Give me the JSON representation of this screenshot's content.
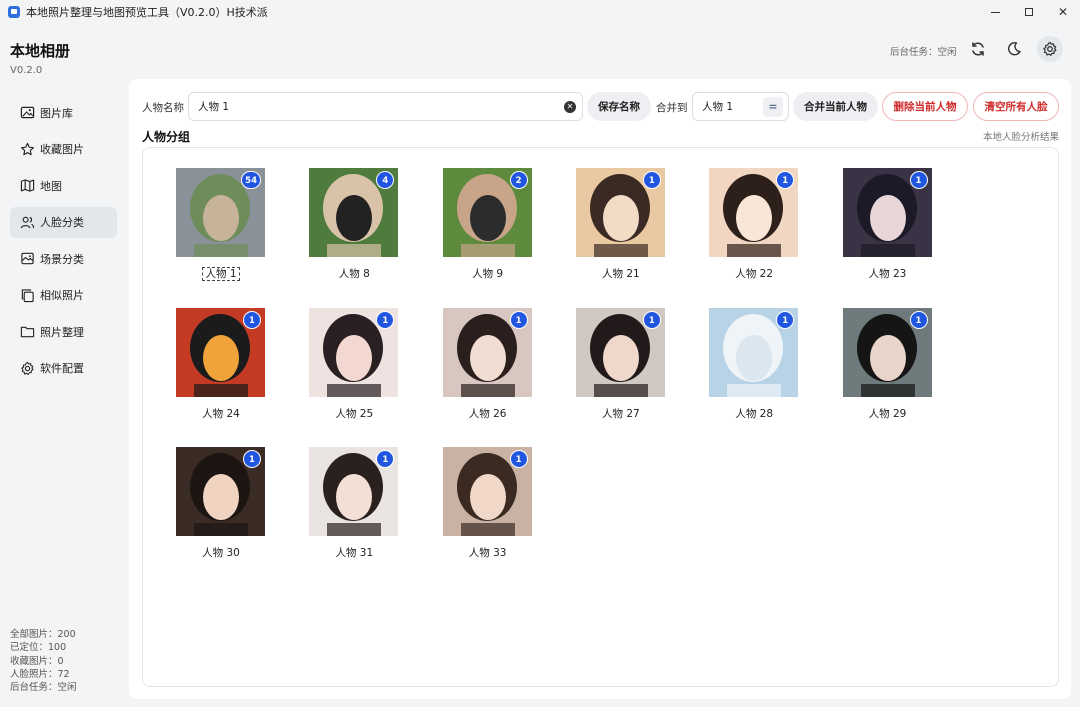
{
  "window": {
    "title": "本地照片整理与地图预览工具（V0.2.0）H技术派"
  },
  "brand": {
    "title": "本地相册",
    "version": "V0.2.0"
  },
  "nav": [
    {
      "label": "图片库",
      "icon": "image-icon"
    },
    {
      "label": "收藏图片",
      "icon": "star-icon"
    },
    {
      "label": "地图",
      "icon": "map-icon"
    },
    {
      "label": "人脸分类",
      "icon": "users-icon",
      "active": true
    },
    {
      "label": "场景分类",
      "icon": "scene-icon"
    },
    {
      "label": "相似照片",
      "icon": "copy-icon"
    },
    {
      "label": "照片整理",
      "icon": "folder-icon"
    },
    {
      "label": "软件配置",
      "icon": "gear-icon"
    }
  ],
  "stats": {
    "total": "全部图片：200",
    "located": "已定位：100",
    "favorites": "收藏图片：0",
    "faces": "人脸照片：72",
    "bg_task": "后台任务：空闲"
  },
  "header": {
    "bg_task": "后台任务：空闲"
  },
  "toolbar": {
    "name_label": "人物名称",
    "name_value": "人物 1",
    "save_label": "保存名称",
    "merge_label": "合并到",
    "merge_value": "人物 1",
    "merge_btn": "合并当前人物",
    "delete_btn": "删除当前人物",
    "clear_btn": "清空所有人脸"
  },
  "section": {
    "title": "人物分组",
    "note": "本地人脸分析结果"
  },
  "people": [
    {
      "name": "人物 1",
      "count": "54",
      "selected": true
    },
    {
      "name": "人物 8",
      "count": "4"
    },
    {
      "name": "人物 9",
      "count": "2"
    },
    {
      "name": "人物 21",
      "count": "1"
    },
    {
      "name": "人物 22",
      "count": "1"
    },
    {
      "name": "人物 23",
      "count": "1"
    },
    {
      "name": "人物 24",
      "count": "1"
    },
    {
      "name": "人物 25",
      "count": "1"
    },
    {
      "name": "人物 26",
      "count": "1"
    },
    {
      "name": "人物 27",
      "count": "1"
    },
    {
      "name": "人物 28",
      "count": "1"
    },
    {
      "name": "人物 29",
      "count": "1"
    },
    {
      "name": "人物 30",
      "count": "1"
    },
    {
      "name": "人物 31",
      "count": "1"
    },
    {
      "name": "人物 33",
      "count": "1"
    }
  ],
  "colors": {
    "accent": "#2156e0",
    "danger": "#d02b2b",
    "active_nav": "#e3e6ea"
  }
}
